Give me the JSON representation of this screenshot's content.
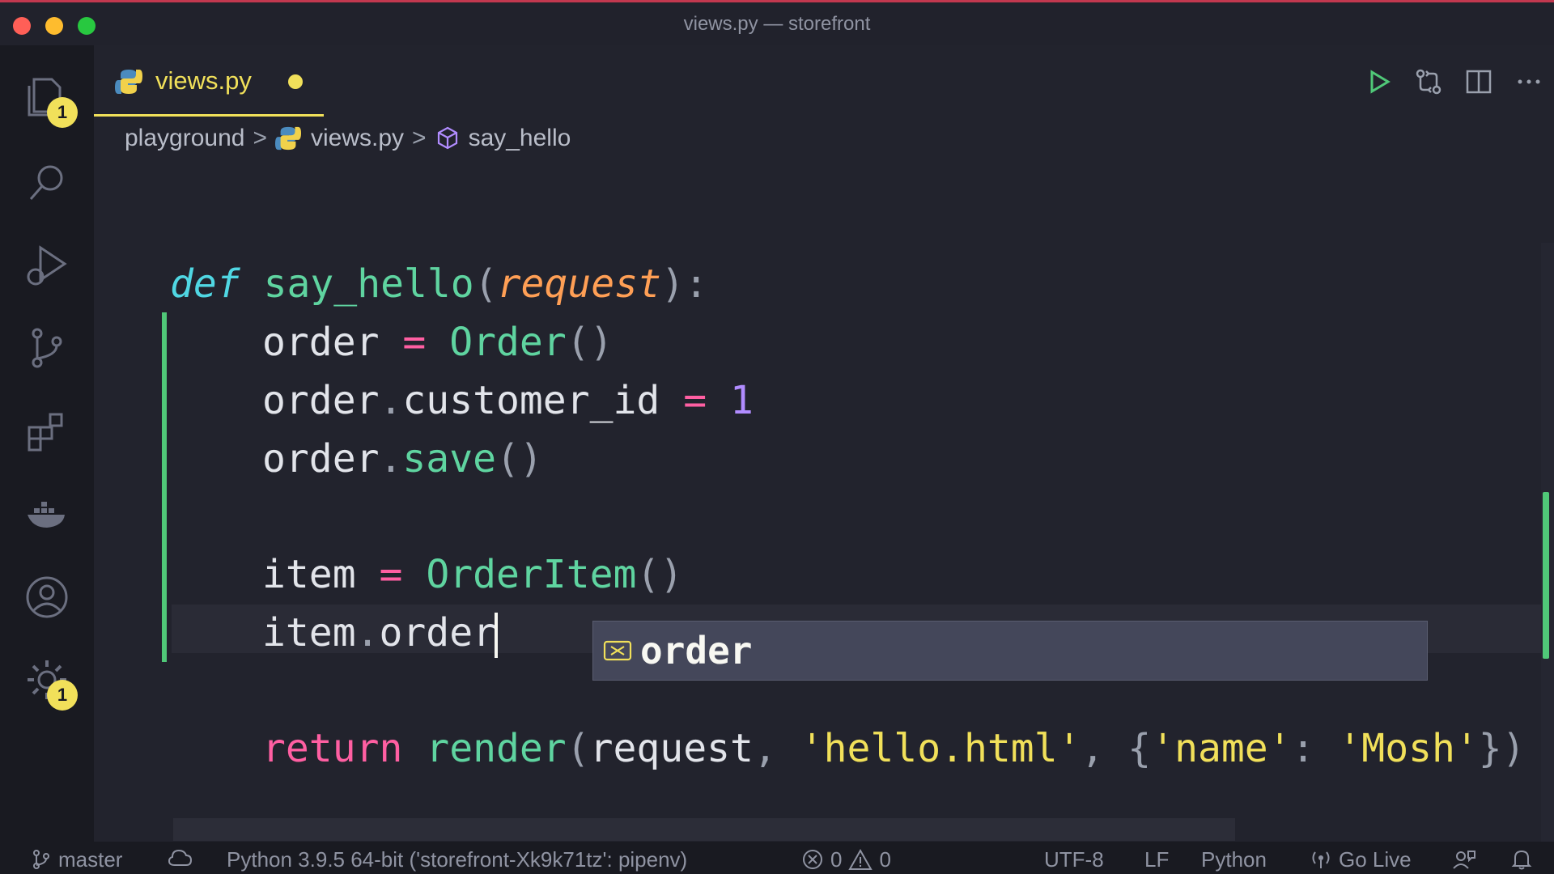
{
  "window": {
    "title": "views.py — storefront"
  },
  "activity_bar": {
    "items": [
      {
        "name": "explorer",
        "icon": "files-icon",
        "badge": "1"
      },
      {
        "name": "search",
        "icon": "search-icon"
      },
      {
        "name": "run-debug",
        "icon": "run-debug-icon"
      },
      {
        "name": "source-control",
        "icon": "source-control-icon"
      },
      {
        "name": "extensions",
        "icon": "extensions-icon"
      },
      {
        "name": "docker",
        "icon": "docker-icon"
      },
      {
        "name": "accounts",
        "icon": "account-icon"
      },
      {
        "name": "manage",
        "icon": "gear-icon",
        "badge": "1"
      }
    ]
  },
  "tab": {
    "label": "views.py",
    "modified": true,
    "icon": "python-icon"
  },
  "tab_actions": [
    "run-icon",
    "compare-changes-icon",
    "split-editor-icon",
    "more-actions-icon"
  ],
  "breadcrumb": {
    "folder": "playground",
    "file": "views.py",
    "symbol": "say_hello"
  },
  "code": {
    "l1": {
      "def": "def",
      "name": "say_hello",
      "open": "(",
      "param": "request",
      "close": "):"
    },
    "l2": {
      "var": "order",
      "eq": "=",
      "cls": "Order",
      "parens": "()"
    },
    "l3": {
      "var": "order",
      "dot": ".",
      "attr": "customer_id",
      "eq": "=",
      "num": "1"
    },
    "l4": {
      "var": "order",
      "dot": ".",
      "method": "save",
      "parens": "()"
    },
    "l6": {
      "var": "item",
      "eq": "=",
      "cls": "OrderItem",
      "parens": "()"
    },
    "l7": {
      "var": "item",
      "dot": ".",
      "attr": "order"
    },
    "l9": {
      "ret": "return",
      "fn": "render",
      "open": "(",
      "arg1": "request",
      "comma1": ",",
      "str1": "'hello.html'",
      "comma2": ",",
      "brace_open": "{",
      "key": "'name'",
      "colon": ":",
      "val": "'Mosh'",
      "close": "})"
    }
  },
  "suggestion": {
    "icon": "field-icon",
    "label": "order"
  },
  "statusbar": {
    "branch": "master",
    "interpreter": "Python 3.9.5 64-bit ('storefront-Xk9k71tz': pipenv)",
    "errors": "0",
    "warnings": "0",
    "encoding": "UTF-8",
    "eol": "LF",
    "language": "Python",
    "go_live": "Go Live"
  },
  "colors": {
    "accent": "#f1e05a",
    "git_added": "#50c878",
    "background": "#22232d"
  }
}
